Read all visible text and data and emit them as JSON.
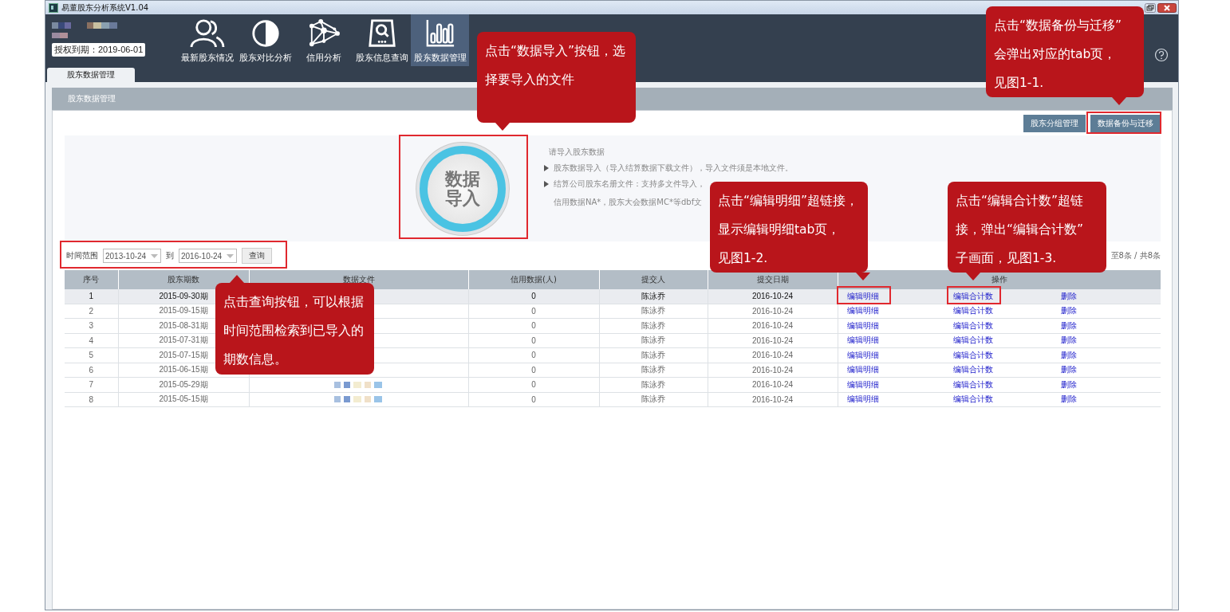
{
  "window": {
    "title": "易董股东分析系统V1.04"
  },
  "license": "授权到期：2019-06-01",
  "nav": [
    {
      "label": "最新股东情况",
      "selected": false
    },
    {
      "label": "股东对比分析",
      "selected": false
    },
    {
      "label": "信用分析",
      "selected": false
    },
    {
      "label": "股东信息查询",
      "selected": false
    },
    {
      "label": "股东数据管理",
      "selected": true
    }
  ],
  "tabs": [
    {
      "label": "股东数据管理",
      "selected": true
    }
  ],
  "panel": {
    "title": "股东数据管理"
  },
  "actions": [
    "股东分组管理",
    "数据备份与迁移"
  ],
  "import": {
    "button": "数据导入",
    "heading": "请导入股东数据",
    "items": [
      {
        "lines": [
          "股东数据导入（导入结算数据下载文件），导入文件须是本地文件。"
        ]
      },
      {
        "lines": [
          "结算公司股东名册文件：支持多文件导入，",
          "信用数据NA*，股东大会数据MC*等dbf文"
        ]
      }
    ]
  },
  "filter": {
    "label": "时间范围",
    "from": "2013-10-24",
    "separator": "到",
    "to": "2016-10-24",
    "button": "查询"
  },
  "pagination": "至8条 / 共8条",
  "table": {
    "columns": [
      "序号",
      "股东期数",
      "数据文件",
      "信用数据(人)",
      "提交人",
      "提交日期",
      "操作"
    ],
    "rows": [
      {
        "cells": [
          "1",
          "2015-09-30期",
          "",
          "0",
          "陈泳乔",
          "2016-10-24"
        ],
        "links": [
          "编辑明细",
          "编辑合计数",
          "删除"
        ],
        "selected": true
      },
      {
        "cells": [
          "2",
          "2015-09-15期",
          "",
          "0",
          "陈泳乔",
          "2016-10-24"
        ],
        "links": [
          "编辑明细",
          "编辑合计数",
          "删除"
        ],
        "selected": false
      },
      {
        "cells": [
          "3",
          "2015-08-31期",
          "",
          "0",
          "陈泳乔",
          "2016-10-24"
        ],
        "links": [
          "编辑明细",
          "编辑合计数",
          "删除"
        ],
        "selected": false
      },
      {
        "cells": [
          "4",
          "2015-07-31期",
          "",
          "0",
          "陈泳乔",
          "2016-10-24"
        ],
        "links": [
          "编辑明细",
          "编辑合计数",
          "删除"
        ],
        "selected": false
      },
      {
        "cells": [
          "5",
          "2015-07-15期",
          "",
          "0",
          "陈泳乔",
          "2016-10-24"
        ],
        "links": [
          "编辑明细",
          "编辑合计数",
          "删除"
        ],
        "selected": false
      },
      {
        "cells": [
          "6",
          "2015-06-15期",
          "",
          "0",
          "陈泳乔",
          "2016-10-24"
        ],
        "links": [
          "编辑明细",
          "编辑合计数",
          "删除"
        ],
        "selected": false
      },
      {
        "cells": [
          "7",
          "2015-05-29期",
          "",
          "0",
          "陈泳乔",
          "2016-10-24"
        ],
        "links": [
          "编辑明细",
          "编辑合计数",
          "删除"
        ],
        "selected": false
      },
      {
        "cells": [
          "8",
          "2015-05-15期",
          "",
          "0",
          "陈泳乔",
          "2016-10-24"
        ],
        "links": [
          "编辑明细",
          "编辑合计数",
          "删除"
        ],
        "selected": false
      }
    ]
  },
  "callouts": [
    {
      "lines": [
        "点击“数据导入”按钮，选",
        "择要导入的文件"
      ]
    },
    {
      "lines": [
        "点击“数据备份与迁移”",
        "会弹出对应的tab页，",
        "见图1-1."
      ]
    },
    {
      "lines": [
        "点击查询按钮，可以根据",
        "时间范围检索到已导入的",
        "期数信息。"
      ]
    },
    {
      "lines": [
        "点击“编辑明细”超链接，",
        "显示编辑明细tab页，",
        "见图1-2."
      ]
    },
    {
      "lines": [
        "点击“编辑合计数”超链",
        "接，弹出“编辑合计数”",
        "子画面，见图1-3."
      ]
    }
  ]
}
